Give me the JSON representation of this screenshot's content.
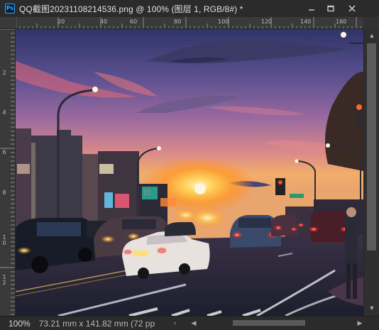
{
  "window": {
    "app_icon_text": "Ps",
    "title": "QQ截图20231108214536.png @ 100% (图层 1, RGB/8#) *",
    "close_symbol": "×"
  },
  "ruler_top": [
    "20",
    "40",
    "60",
    "80",
    "100",
    "120",
    "140",
    "160"
  ],
  "ruler_left": [
    "2",
    "4",
    "6",
    "8",
    "1\n0",
    "1\n2"
  ],
  "status": {
    "zoom": "100%",
    "doc_info": "73.21 mm x 141.82 mm (72 pp",
    "arrow": "›"
  },
  "scroll": {
    "up": "▲",
    "down": "▼",
    "left": "◀",
    "right": "▶"
  },
  "colors": {
    "titlebar": "#2b2b2b",
    "panel": "#323232",
    "ruler": "#3a3a3a",
    "ps_blue": "#31a8ff",
    "ps_dark": "#001e36"
  },
  "image": {
    "description_icon": "sunset-street-photo"
  }
}
